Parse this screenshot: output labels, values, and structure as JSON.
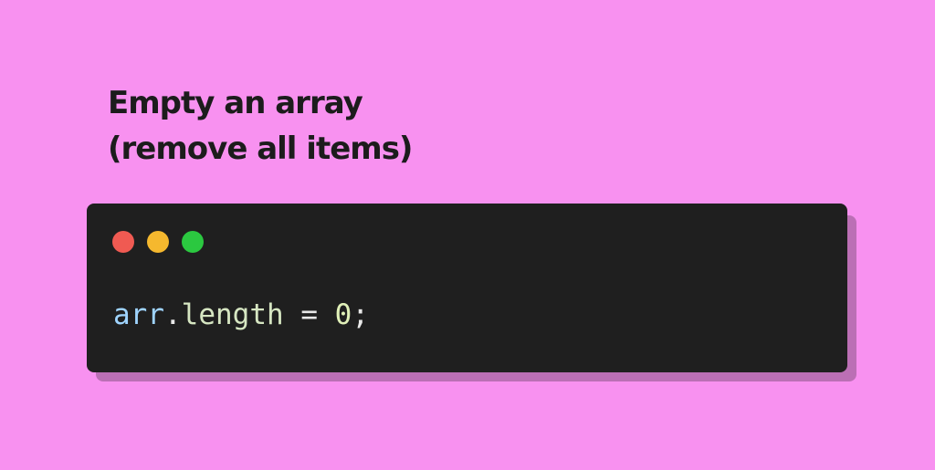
{
  "title": {
    "line1": "Empty an array",
    "line2": "(remove all items)"
  },
  "window_controls": [
    {
      "name": "close",
      "color": "#f05a52"
    },
    {
      "name": "minimize",
      "color": "#f5b82e"
    },
    {
      "name": "maximize",
      "color": "#2bc840"
    }
  ],
  "code": {
    "tokens": [
      {
        "text": "arr",
        "color": "#9fd4ff"
      },
      {
        "text": ".",
        "color": "#e8e8e8"
      },
      {
        "text": "length",
        "color": "#d6e6c2"
      },
      {
        "text": " = ",
        "color": "#e8e8e8"
      },
      {
        "text": "0",
        "color": "#e0f0b8"
      },
      {
        "text": ";",
        "color": "#e8e8e8"
      }
    ]
  },
  "colors": {
    "background": "#f891f0",
    "window": "#1f1f1f",
    "window_shadow": "#bb6fb5",
    "title_text": "#1c1c1c"
  }
}
